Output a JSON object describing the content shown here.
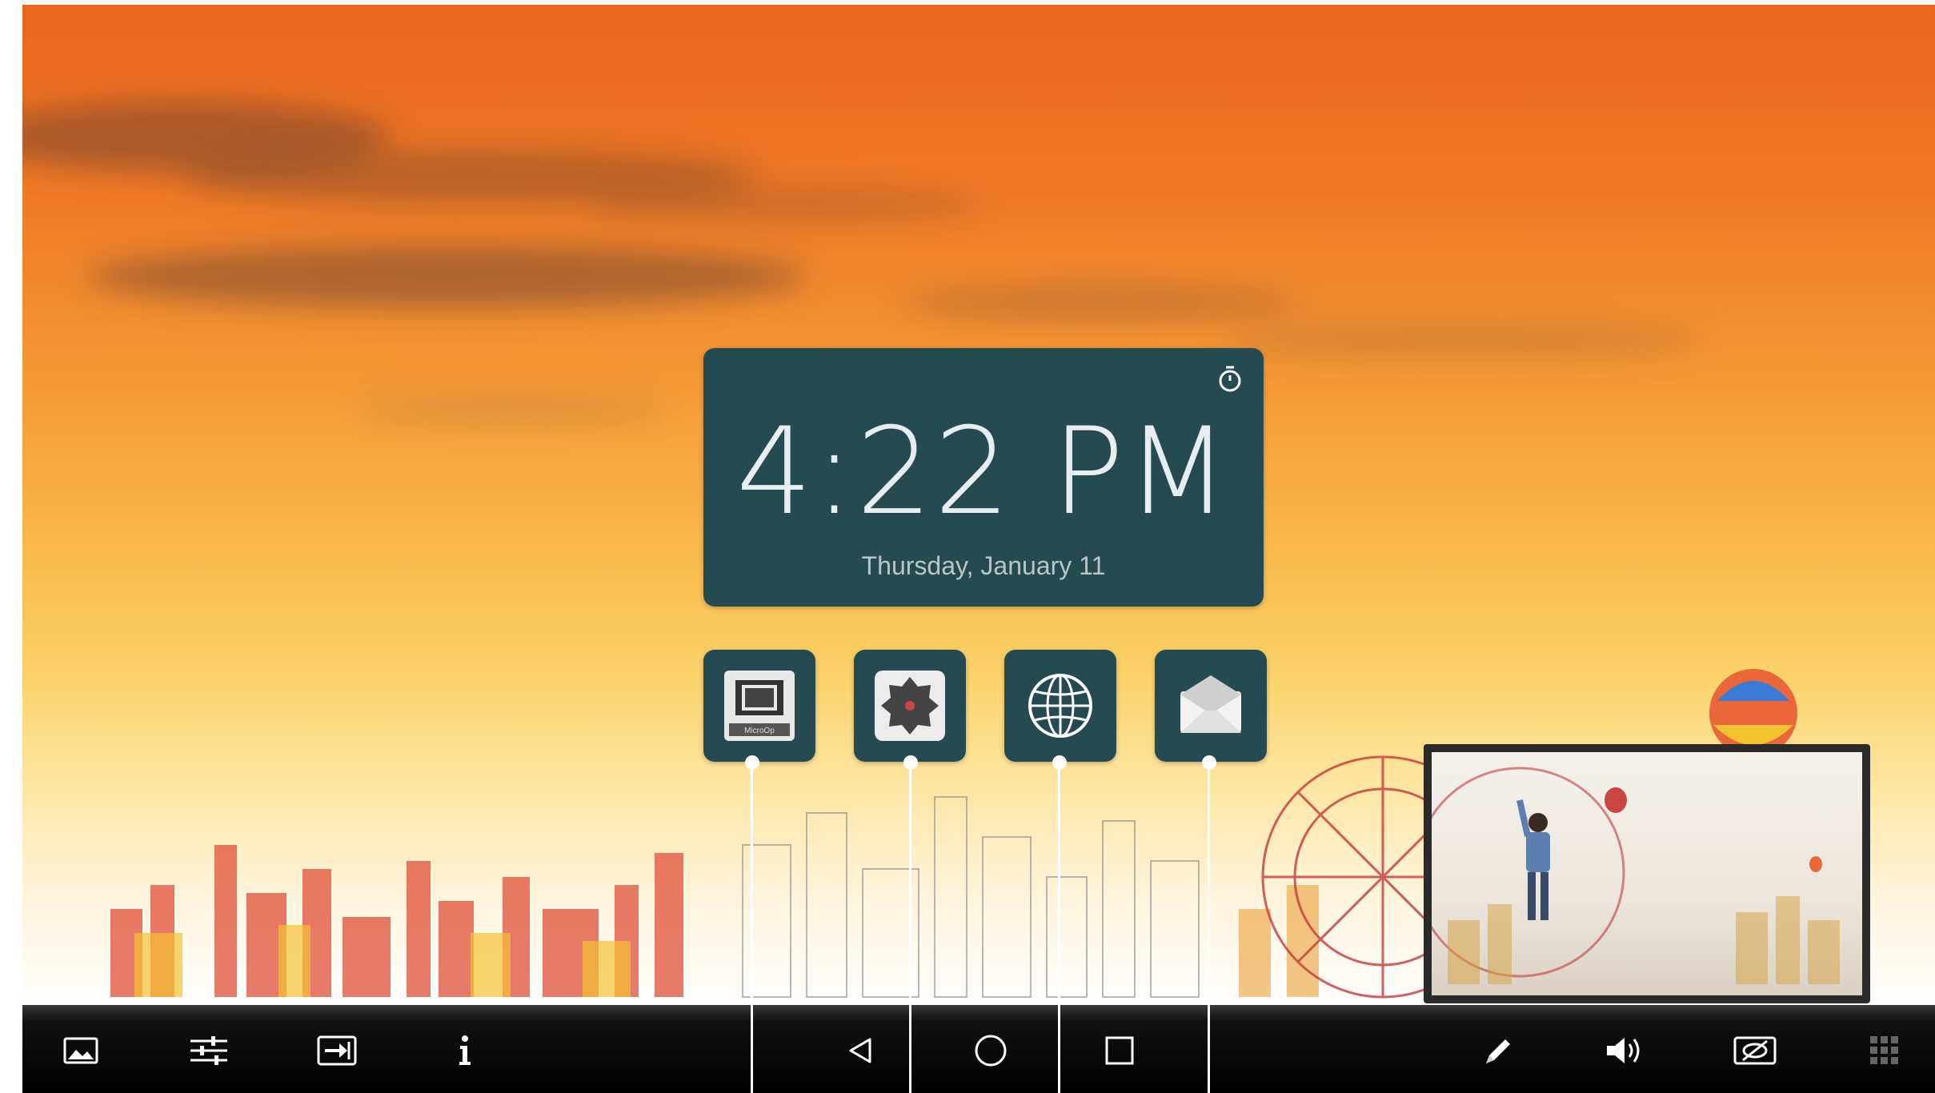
{
  "clock": {
    "time": "4:22 PM",
    "date": "Thursday, January 11",
    "alarm_icon": "stopwatch-icon"
  },
  "apps": [
    {
      "name": "microop",
      "label": "MicroOp",
      "icon": "microop-icon"
    },
    {
      "name": "settings",
      "label": "",
      "icon": "settings-badge-icon"
    },
    {
      "name": "browser",
      "label": "",
      "icon": "globe-icon"
    },
    {
      "name": "email",
      "label": "",
      "icon": "envelope-icon"
    }
  ],
  "taskbar": {
    "left": [
      "wallpaper-icon",
      "sliders-icon",
      "input-source-icon",
      "info-icon"
    ],
    "center": [
      "back-icon",
      "home-icon",
      "recents-icon"
    ],
    "right": [
      "pen-icon",
      "volume-icon",
      "hide-screen-icon",
      "app-grid-icon"
    ]
  },
  "colors": {
    "tile_bg": "#264a52",
    "taskbar_bg": "#000000",
    "sky_top": "#e9651c",
    "sky_mid": "#f9b84a"
  }
}
